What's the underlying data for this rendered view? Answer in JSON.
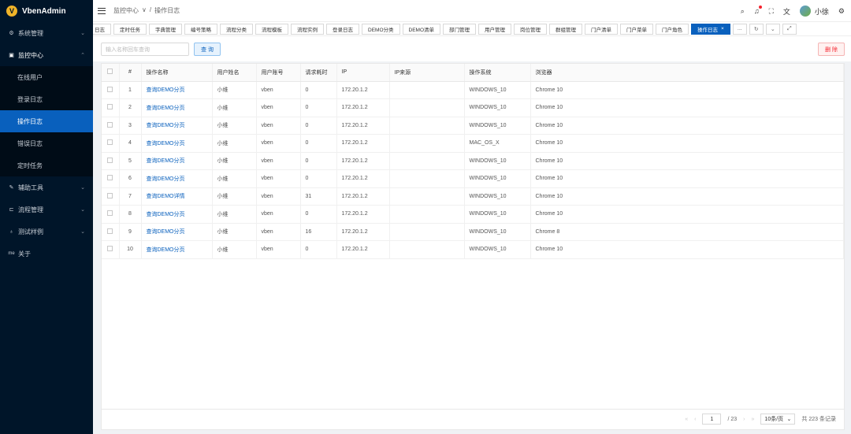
{
  "app": {
    "title": "VbenAdmin",
    "logo_letter": "V"
  },
  "sidebar": {
    "items": [
      {
        "label": "系统管理",
        "icon": "gear-icon",
        "expanded": false
      },
      {
        "label": "监控中心",
        "icon": "monitor-icon",
        "expanded": true,
        "children": [
          {
            "label": "在线用户"
          },
          {
            "label": "登录日志"
          },
          {
            "label": "操作日志",
            "active": true
          },
          {
            "label": "错误日志"
          },
          {
            "label": "定时任务"
          }
        ]
      },
      {
        "label": "辅助工具",
        "icon": "tool-icon",
        "expanded": false
      },
      {
        "label": "流程管理",
        "icon": "flow-icon",
        "expanded": false
      },
      {
        "label": "测试样例",
        "icon": "bulb-icon",
        "expanded": false
      },
      {
        "label": "关于",
        "icon": "me-icon",
        "icon_text": "me"
      }
    ]
  },
  "header": {
    "breadcrumb": [
      "监控中心",
      "/",
      "操作日志"
    ],
    "username": "小徐"
  },
  "tabs": {
    "items": [
      "日志",
      "定时任务",
      "字典管理",
      "编号策略",
      "流程分类",
      "流程模板",
      "流程实例",
      "登录日志",
      "DEMO分类",
      "DEMO清单",
      "部门管理",
      "用户管理",
      "岗位管理",
      "群组管理",
      "门户清单",
      "门户菜单",
      "门户角色"
    ],
    "active": "操作日志",
    "more": "..."
  },
  "toolbar": {
    "search_placeholder": "输入名称回车查询",
    "query_label": "查 询",
    "delete_label": "删 除"
  },
  "table": {
    "headers": [
      "#",
      "操作名称",
      "用户姓名",
      "用户账号",
      "请求耗时",
      "IP",
      "IP来源",
      "操作系统",
      "浏览器"
    ],
    "rows": [
      [
        "1",
        "查询DEMO分页",
        "小维",
        "vben",
        "0",
        "172.20.1.2",
        "",
        "WINDOWS_10",
        "Chrome 10"
      ],
      [
        "2",
        "查询DEMO分页",
        "小维",
        "vben",
        "0",
        "172.20.1.2",
        "",
        "WINDOWS_10",
        "Chrome 10"
      ],
      [
        "3",
        "查询DEMO分页",
        "小维",
        "vben",
        "0",
        "172.20.1.2",
        "",
        "WINDOWS_10",
        "Chrome 10"
      ],
      [
        "4",
        "查询DEMO分页",
        "小维",
        "vben",
        "0",
        "172.20.1.2",
        "",
        "MAC_OS_X",
        "Chrome 10"
      ],
      [
        "5",
        "查询DEMO分页",
        "小维",
        "vben",
        "0",
        "172.20.1.2",
        "",
        "WINDOWS_10",
        "Chrome 10"
      ],
      [
        "6",
        "查询DEMO分页",
        "小维",
        "vben",
        "0",
        "172.20.1.2",
        "",
        "WINDOWS_10",
        "Chrome 10"
      ],
      [
        "7",
        "查询DEMO详情",
        "小维",
        "vben",
        "31",
        "172.20.1.2",
        "",
        "WINDOWS_10",
        "Chrome 10"
      ],
      [
        "8",
        "查询DEMO分页",
        "小维",
        "vben",
        "0",
        "172.20.1.2",
        "",
        "WINDOWS_10",
        "Chrome 10"
      ],
      [
        "9",
        "查询DEMO分页",
        "小维",
        "vben",
        "16",
        "172.20.1.2",
        "",
        "WINDOWS_10",
        "Chrome 8"
      ],
      [
        "10",
        "查询DEMO分页",
        "小维",
        "vben",
        "0",
        "172.20.1.2",
        "",
        "WINDOWS_10",
        "Chrome 10"
      ]
    ]
  },
  "pager": {
    "current_page": "1",
    "total_pages": "/ 23",
    "page_size": "10条/页",
    "total": "共 223 条记录"
  },
  "colors": {
    "sidebar_bg": "#001529",
    "accent": "#0960bd",
    "danger": "#f5222d"
  }
}
